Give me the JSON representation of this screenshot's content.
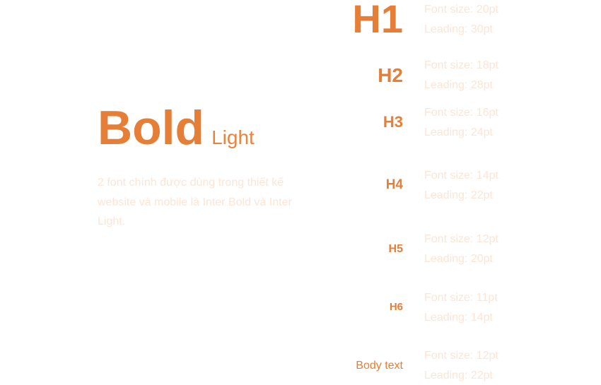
{
  "hero": {
    "bold": "Bold",
    "light": "Light",
    "description": "2 font chính được dùng trong thiết kế website và mobile là Inter Bold và Inter Light."
  },
  "styles": [
    {
      "label": "H1",
      "size": "Font size: 20pt",
      "leading": "Leading: 30pt"
    },
    {
      "label": "H2",
      "size": "Font size: 18pt",
      "leading": "Leading: 28pt"
    },
    {
      "label": "H3",
      "size": "Font size: 16pt",
      "leading": "Leading: 24pt"
    },
    {
      "label": "H4",
      "size": "Font size: 14pt",
      "leading": "Leading: 22pt"
    },
    {
      "label": "H5",
      "size": "Font size: 12pt",
      "leading": "Leading: 20pt"
    },
    {
      "label": "H6",
      "size": "Font size: 11pt",
      "leading": "Leading: 14pt"
    },
    {
      "label": "Body text",
      "size": "Font size: 12pt",
      "leading": "Leading: 22pt"
    }
  ],
  "colors": {
    "accent": "#e57e36",
    "muted": "#fbe5d5"
  }
}
